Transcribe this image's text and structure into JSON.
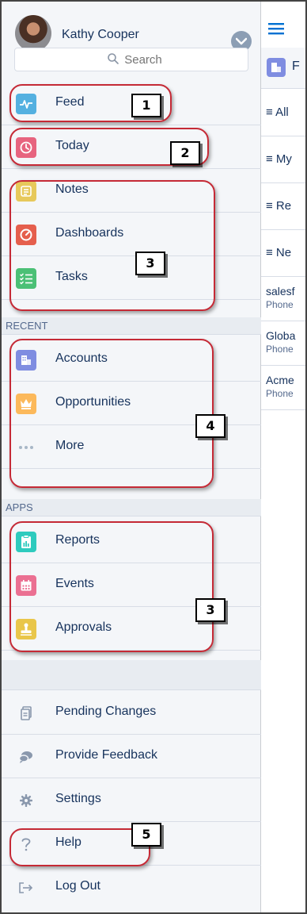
{
  "user": {
    "name": "Kathy Cooper"
  },
  "search": {
    "placeholder": "Search"
  },
  "nav_items": [
    {
      "label": "Feed",
      "icon": "feed-icon",
      "color": "#54b0e0"
    },
    {
      "label": "Today",
      "icon": "clock-icon",
      "color": "#e7647f"
    },
    {
      "label": "Notes",
      "icon": "note-icon",
      "color": "#e7c95b"
    },
    {
      "label": "Dashboards",
      "icon": "gauge-icon",
      "color": "#e55f4d"
    },
    {
      "label": "Tasks",
      "icon": "checklist-icon",
      "color": "#4bc076"
    }
  ],
  "recent": {
    "heading": "RECENT",
    "items": [
      {
        "label": "Accounts",
        "icon": "building-icon",
        "color": "#7f8de1"
      },
      {
        "label": "Opportunities",
        "icon": "crown-icon",
        "color": "#fcb95b"
      },
      {
        "label": "More",
        "icon": "ellipsis-icon",
        "color": "#a8b7c7"
      }
    ]
  },
  "apps": {
    "heading": "APPS",
    "items": [
      {
        "label": "Reports",
        "icon": "report-icon",
        "color": "#2ecbbe"
      },
      {
        "label": "Events",
        "icon": "calendar-icon",
        "color": "#eb7092"
      },
      {
        "label": "Approvals",
        "icon": "stamp-icon",
        "color": "#e9c64a"
      }
    ]
  },
  "utility": [
    {
      "label": "Pending Changes",
      "icon": "document-icon"
    },
    {
      "label": "Provide Feedback",
      "icon": "chat-icon"
    },
    {
      "label": "Settings",
      "icon": "gear-icon"
    },
    {
      "label": "Help",
      "icon": "question-icon"
    },
    {
      "label": "Log Out",
      "icon": "logout-icon"
    }
  ],
  "annotations": [
    "1",
    "2",
    "3",
    "4",
    "3",
    "5"
  ],
  "right_panel": {
    "object_label": "F",
    "list_views": [
      "All",
      "My",
      "Re",
      "Ne"
    ],
    "records": [
      {
        "name": "salesf",
        "sub": "Phone"
      },
      {
        "name": "Globa",
        "sub": "Phone"
      },
      {
        "name": "Acme",
        "sub": "Phone"
      }
    ]
  },
  "colors": {
    "accent": "#0070d2",
    "annotation_ring": "#c52a36",
    "sidebar_bg": "#f4f6f9"
  }
}
